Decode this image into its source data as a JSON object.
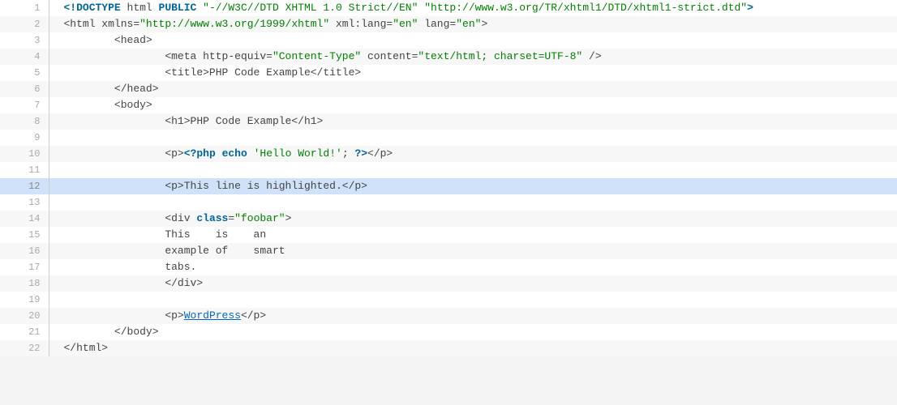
{
  "highlighted_line": 12,
  "lines": [
    {
      "n": 1,
      "indent": 0,
      "tokens": [
        {
          "t": "tag",
          "v": "<!DOCTYPE"
        },
        {
          "t": "plain",
          "v": " html "
        },
        {
          "t": "tag",
          "v": "PUBLIC"
        },
        {
          "t": "plain",
          "v": " "
        },
        {
          "t": "str",
          "v": "\"-//W3C//DTD XHTML 1.0 Strict//EN\""
        },
        {
          "t": "plain",
          "v": " "
        },
        {
          "t": "str",
          "v": "\"http://www.w3.org/TR/xhtml1/DTD/xhtml1-strict.dtd\""
        },
        {
          "t": "tag",
          "v": ">"
        }
      ]
    },
    {
      "n": 2,
      "indent": 0,
      "tokens": [
        {
          "t": "plain",
          "v": "<html xmlns="
        },
        {
          "t": "str",
          "v": "\"http://www.w3.org/1999/xhtml\""
        },
        {
          "t": "plain",
          "v": " xml:lang="
        },
        {
          "t": "str",
          "v": "\"en\""
        },
        {
          "t": "plain",
          "v": " lang="
        },
        {
          "t": "str",
          "v": "\"en\""
        },
        {
          "t": "plain",
          "v": ">"
        }
      ]
    },
    {
      "n": 3,
      "indent": 8,
      "tokens": [
        {
          "t": "plain",
          "v": "<head>"
        }
      ]
    },
    {
      "n": 4,
      "indent": 16,
      "tokens": [
        {
          "t": "plain",
          "v": "<meta http-equiv="
        },
        {
          "t": "str",
          "v": "\"Content-Type\""
        },
        {
          "t": "plain",
          "v": " content="
        },
        {
          "t": "str",
          "v": "\"text/html; charset=UTF-8\""
        },
        {
          "t": "plain",
          "v": " />"
        }
      ]
    },
    {
      "n": 5,
      "indent": 16,
      "tokens": [
        {
          "t": "plain",
          "v": "<title>PHP Code Example</title>"
        }
      ]
    },
    {
      "n": 6,
      "indent": 8,
      "tokens": [
        {
          "t": "plain",
          "v": "</head>"
        }
      ]
    },
    {
      "n": 7,
      "indent": 8,
      "tokens": [
        {
          "t": "plain",
          "v": "<body>"
        }
      ]
    },
    {
      "n": 8,
      "indent": 16,
      "tokens": [
        {
          "t": "plain",
          "v": "<h1>PHP Code Example</h1>"
        }
      ]
    },
    {
      "n": 9,
      "indent": 0,
      "tokens": []
    },
    {
      "n": 10,
      "indent": 16,
      "tokens": [
        {
          "t": "plain",
          "v": "<p>"
        },
        {
          "t": "tag",
          "v": "<?php"
        },
        {
          "t": "plain",
          "v": " "
        },
        {
          "t": "kw",
          "v": "echo"
        },
        {
          "t": "plain",
          "v": " "
        },
        {
          "t": "lit",
          "v": "'Hello World!'"
        },
        {
          "t": "plain",
          "v": "; "
        },
        {
          "t": "tag",
          "v": "?>"
        },
        {
          "t": "plain",
          "v": "</p>"
        }
      ]
    },
    {
      "n": 11,
      "indent": 0,
      "tokens": []
    },
    {
      "n": 12,
      "indent": 16,
      "tokens": [
        {
          "t": "plain",
          "v": "<p>This line is highlighted.</p>"
        }
      ]
    },
    {
      "n": 13,
      "indent": 0,
      "tokens": []
    },
    {
      "n": 14,
      "indent": 16,
      "tokens": [
        {
          "t": "plain",
          "v": "<div "
        },
        {
          "t": "kw",
          "v": "class"
        },
        {
          "t": "plain",
          "v": "="
        },
        {
          "t": "str",
          "v": "\"foobar\""
        },
        {
          "t": "plain",
          "v": ">"
        }
      ]
    },
    {
      "n": 15,
      "indent": 16,
      "tokens": [
        {
          "t": "plain",
          "v": "This    is    an"
        }
      ]
    },
    {
      "n": 16,
      "indent": 16,
      "tokens": [
        {
          "t": "plain",
          "v": "example of    smart"
        }
      ]
    },
    {
      "n": 17,
      "indent": 16,
      "tokens": [
        {
          "t": "plain",
          "v": "tabs."
        }
      ]
    },
    {
      "n": 18,
      "indent": 16,
      "tokens": [
        {
          "t": "plain",
          "v": "</div>"
        }
      ]
    },
    {
      "n": 19,
      "indent": 0,
      "tokens": []
    },
    {
      "n": 20,
      "indent": 16,
      "tokens": [
        {
          "t": "plain",
          "v": "<p>"
        },
        {
          "t": "link",
          "v": "WordPress"
        },
        {
          "t": "plain",
          "v": "</p>"
        }
      ]
    },
    {
      "n": 21,
      "indent": 8,
      "tokens": [
        {
          "t": "plain",
          "v": "</body>"
        }
      ]
    },
    {
      "n": 22,
      "indent": 0,
      "tokens": [
        {
          "t": "plain",
          "v": "</html>"
        }
      ]
    }
  ]
}
